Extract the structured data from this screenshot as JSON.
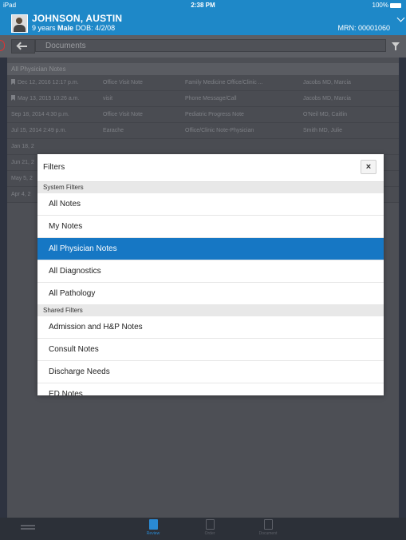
{
  "status_bar": {
    "device": "iPad",
    "time": "2:38 PM",
    "battery": "100%"
  },
  "patient": {
    "name": "JOHNSON, AUSTIN",
    "age": "9 years",
    "sex": "Male",
    "dob": "DOB: 4/2/08",
    "mrn": "MRN: 00001060"
  },
  "toolbar": {
    "title": "Documents"
  },
  "list": {
    "section_header": "All Physician Notes",
    "rows": [
      {
        "date": "Dec 12, 2016 12:17 p.m.",
        "type": "Office Visit Note",
        "location": "Family Medicine Office/Clinic ...",
        "provider": "Jacobs MD, Marcia",
        "bookmarked": true
      },
      {
        "date": "May 13, 2015 10:26 a.m.",
        "type": "visit",
        "location": "Phone Message/Call",
        "provider": "Jacobs MD, Marcia",
        "bookmarked": true
      },
      {
        "date": "Sep 18, 2014 4:30 p.m.",
        "type": "Office Visit Note",
        "location": "Pediatric Progress Note",
        "provider": "O'Neil MD, Caitlin",
        "bookmarked": false
      },
      {
        "date": "Jul 15, 2014 2:49 p.m.",
        "type": "Earache",
        "location": "Office/Clinic Note-Physician",
        "provider": "Smith MD, Julie",
        "bookmarked": false
      },
      {
        "date": "Jan 18, 2",
        "type": "",
        "location": "",
        "provider": "",
        "bookmarked": false
      },
      {
        "date": "Jun 21, 2",
        "type": "",
        "location": "",
        "provider": "",
        "bookmarked": false
      },
      {
        "date": "May 5, 2",
        "type": "",
        "location": "",
        "provider": "",
        "bookmarked": false
      },
      {
        "date": "Apr 4, 2",
        "type": "",
        "location": "",
        "provider": "",
        "bookmarked": false
      }
    ]
  },
  "filters_modal": {
    "title": "Filters",
    "close_label": "×",
    "system_header": "System Filters",
    "system_filters": [
      "All Notes",
      "My Notes",
      "All Physician Notes",
      "All Diagnostics",
      "All Pathology"
    ],
    "selected": "All Physician Notes",
    "shared_header": "Shared Filters",
    "shared_filters": [
      "Admission and H&P Notes",
      "Consult Notes",
      "Discharge Needs",
      "ED Notes"
    ]
  },
  "tab_bar": {
    "tabs": [
      {
        "label": "Review",
        "icon": "clipboard-icon",
        "active": true
      },
      {
        "label": "Order",
        "icon": "order-grid-icon",
        "active": false
      },
      {
        "label": "Document",
        "icon": "document-icon",
        "active": false
      }
    ]
  }
}
